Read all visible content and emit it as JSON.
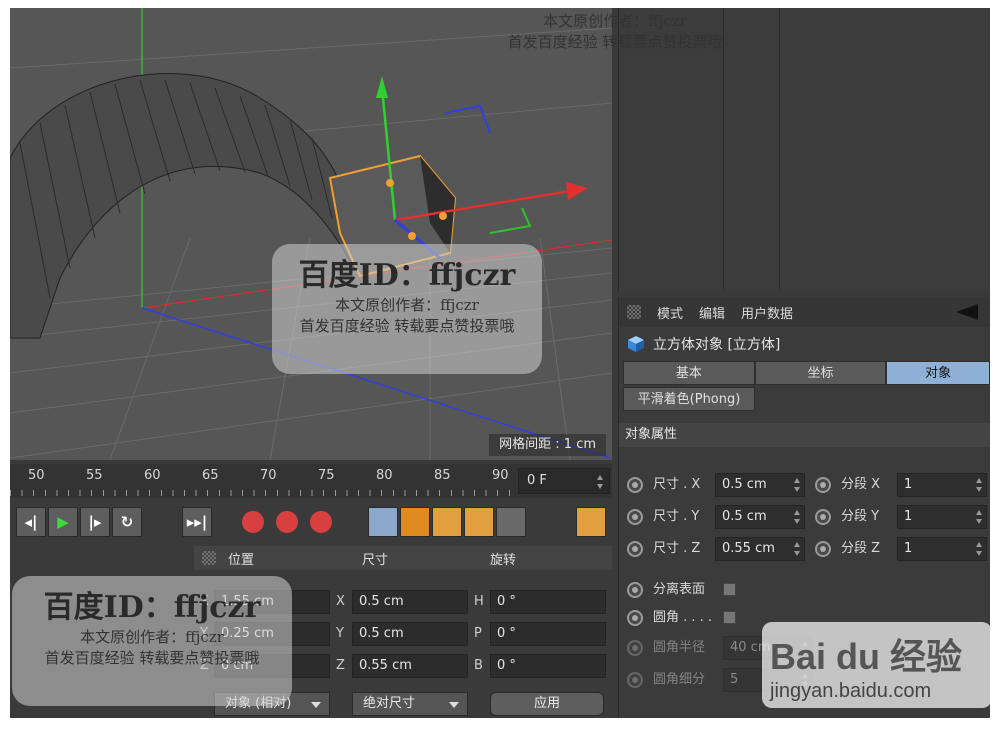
{
  "viewport": {
    "grid_info": "网格间距 : 1 cm"
  },
  "attributes": {
    "menu": [
      "模式",
      "编辑",
      "用户数据"
    ],
    "object_title": "立方体对象 [立方体]",
    "tabs": [
      {
        "label": "基本",
        "active": false
      },
      {
        "label": "坐标",
        "active": false
      },
      {
        "label": "对象",
        "active": true
      }
    ],
    "phong_tab": "平滑着色(Phong)",
    "section": "对象属性",
    "size_x_label": "尺寸 . X",
    "size_x": "0.5 cm",
    "size_y_label": "尺寸 . Y",
    "size_y": "0.5 cm",
    "size_z_label": "尺寸 . Z",
    "size_z": "0.55 cm",
    "seg_x_label": "分段 X",
    "seg_x": "1",
    "seg_y_label": "分段 Y",
    "seg_y": "1",
    "seg_z_label": "分段 Z",
    "seg_z": "1",
    "separate_surfaces": "分离表面",
    "fillet": "圆角 . . . .",
    "fillet_radius_label": "圆角半径",
    "fillet_radius": "40 cm",
    "fillet_subdiv_label": "圆角细分",
    "fillet_subdiv": "5"
  },
  "timeline": {
    "ticks": [
      "50",
      "55",
      "60",
      "65",
      "70",
      "75",
      "80",
      "85",
      "90"
    ],
    "frame": "0 F"
  },
  "coordinates": {
    "header": {
      "position": "位置",
      "size": "尺寸",
      "rotation": "旋转"
    },
    "pos": [
      {
        "axis": "X",
        "value": "1.55 cm"
      },
      {
        "axis": "Y",
        "value": "0.25 cm"
      },
      {
        "axis": "Z",
        "value": "0 cm"
      }
    ],
    "size": [
      {
        "axis": "X",
        "value": "0.5 cm"
      },
      {
        "axis": "Y",
        "value": "0.5 cm"
      },
      {
        "axis": "Z",
        "value": "0.55 cm"
      }
    ],
    "rot": [
      {
        "axis": "H",
        "value": "0 °"
      },
      {
        "axis": "P",
        "value": "0 °"
      },
      {
        "axis": "B",
        "value": "0 °"
      }
    ],
    "mode_dropdown": "对象 (相对)",
    "size_dropdown": "绝对尺寸",
    "apply": "应用"
  },
  "watermarks": {
    "id": "百度ID：ffjczr",
    "line1": "本文原创作者：ffjczr",
    "line2": "首发百度经验  转载要点赞投票哦",
    "brand": "Bai du 经验",
    "url": "jingyan.baidu.com"
  },
  "colors": {
    "accent_tab": "#8fb1d6",
    "axis_x": "#e03030",
    "axis_y": "#30c030",
    "axis_z": "#3040e0",
    "selection": "#f0a030"
  }
}
